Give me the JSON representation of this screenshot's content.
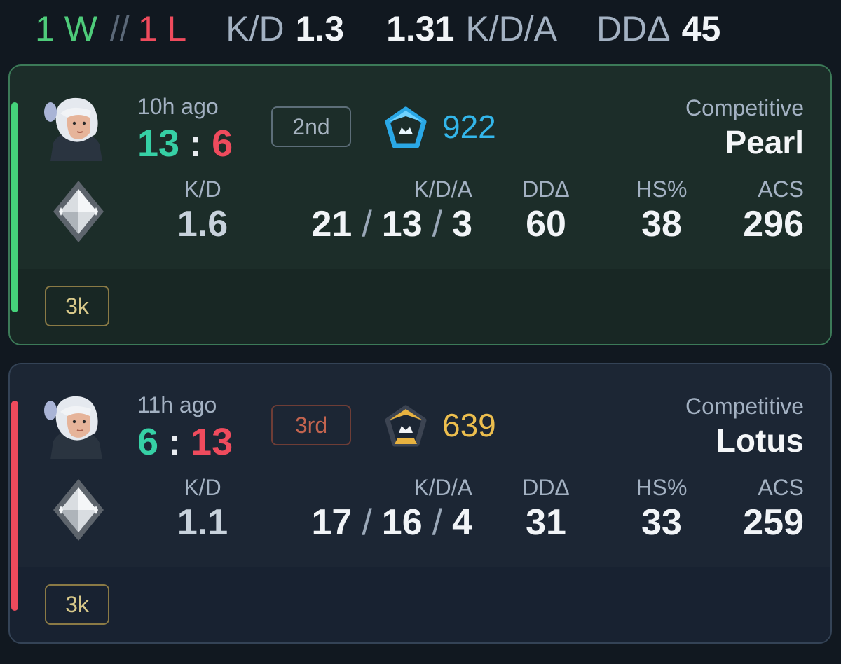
{
  "summary": {
    "wins": "1 W",
    "separator": "//",
    "losses": "1 L",
    "kd_label": "K/D",
    "kd_value": "1.3",
    "kda_value": "1.31",
    "kda_label": "K/D/A",
    "dd_label": "DDΔ",
    "dd_value": "45"
  },
  "colors": {
    "win": "#45d27a",
    "loss": "#ee4a5c",
    "own_score": "#36d0a5",
    "rr_up": "#33b6ea",
    "rr_down": "#ecbe4e"
  },
  "matches": [
    {
      "result": "win",
      "agent_icon": "agent-portrait-icon",
      "time_ago": "10h ago",
      "score_own": "13",
      "score_sep": ":",
      "score_opp": "6",
      "placement": "2nd",
      "rank_icon": "rank-emblem-blue-icon",
      "rr": "922",
      "mode": "Competitive",
      "map": "Pearl",
      "tier_icon": "diamond-tier-icon",
      "stats": {
        "kd_label": "K/D",
        "kd": "1.6",
        "kda_label": "K/D/A",
        "kills": "21",
        "deaths": "13",
        "assists": "3",
        "dd_label": "DDΔ",
        "dd": "60",
        "hs_label": "HS%",
        "hs": "38",
        "acs_label": "ACS",
        "acs": "296"
      },
      "badge": "3k"
    },
    {
      "result": "loss",
      "agent_icon": "agent-portrait-icon",
      "time_ago": "11h ago",
      "score_own": "6",
      "score_sep": ":",
      "score_opp": "13",
      "placement": "3rd",
      "rank_icon": "rank-emblem-gold-icon",
      "rr": "639",
      "mode": "Competitive",
      "map": "Lotus",
      "tier_icon": "diamond-tier-icon",
      "stats": {
        "kd_label": "K/D",
        "kd": "1.1",
        "kda_label": "K/D/A",
        "kills": "17",
        "deaths": "16",
        "assists": "4",
        "dd_label": "DDΔ",
        "dd": "31",
        "hs_label": "HS%",
        "hs": "33",
        "acs_label": "ACS",
        "acs": "259"
      },
      "badge": "3k"
    }
  ]
}
